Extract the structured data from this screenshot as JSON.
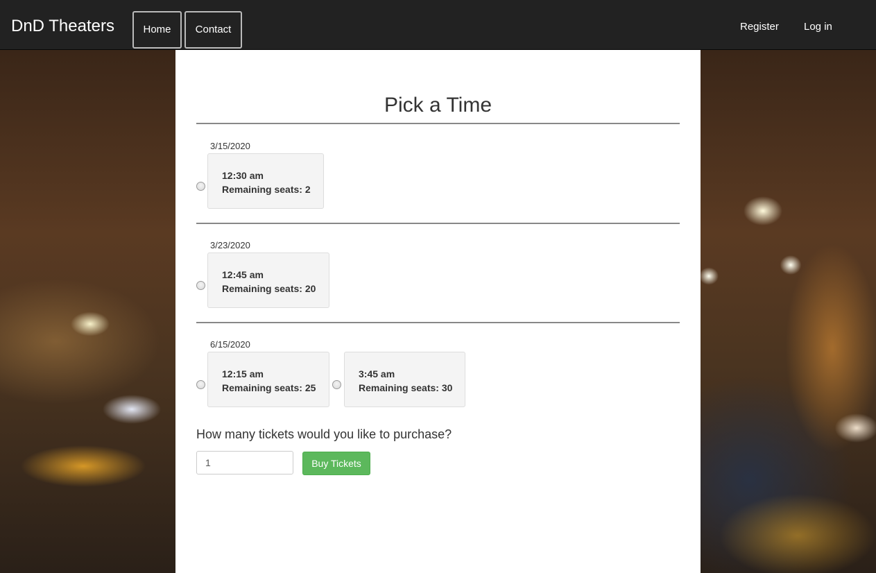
{
  "nav": {
    "brand": "DnD Theaters",
    "home": "Home",
    "contact": "Contact",
    "register": "Register",
    "login": "Log in"
  },
  "page": {
    "title": "Pick a Time"
  },
  "showings": [
    {
      "date": "3/15/2020",
      "slots": [
        {
          "time": "12:30 am",
          "seats": "Remaining seats: 2"
        }
      ]
    },
    {
      "date": "3/23/2020",
      "slots": [
        {
          "time": "12:45 am",
          "seats": "Remaining seats: 20"
        }
      ]
    },
    {
      "date": "6/15/2020",
      "slots": [
        {
          "time": "12:15 am",
          "seats": "Remaining seats: 25"
        },
        {
          "time": "3:45 am",
          "seats": "Remaining seats: 30"
        }
      ]
    }
  ],
  "purchase": {
    "question": "How many tickets would you like to purchase?",
    "quantity": "1",
    "button": "Buy Tickets"
  },
  "colors": {
    "navbar": "#222222",
    "buy_button": "#5cb85c",
    "slot_background": "#f4f4f4"
  }
}
